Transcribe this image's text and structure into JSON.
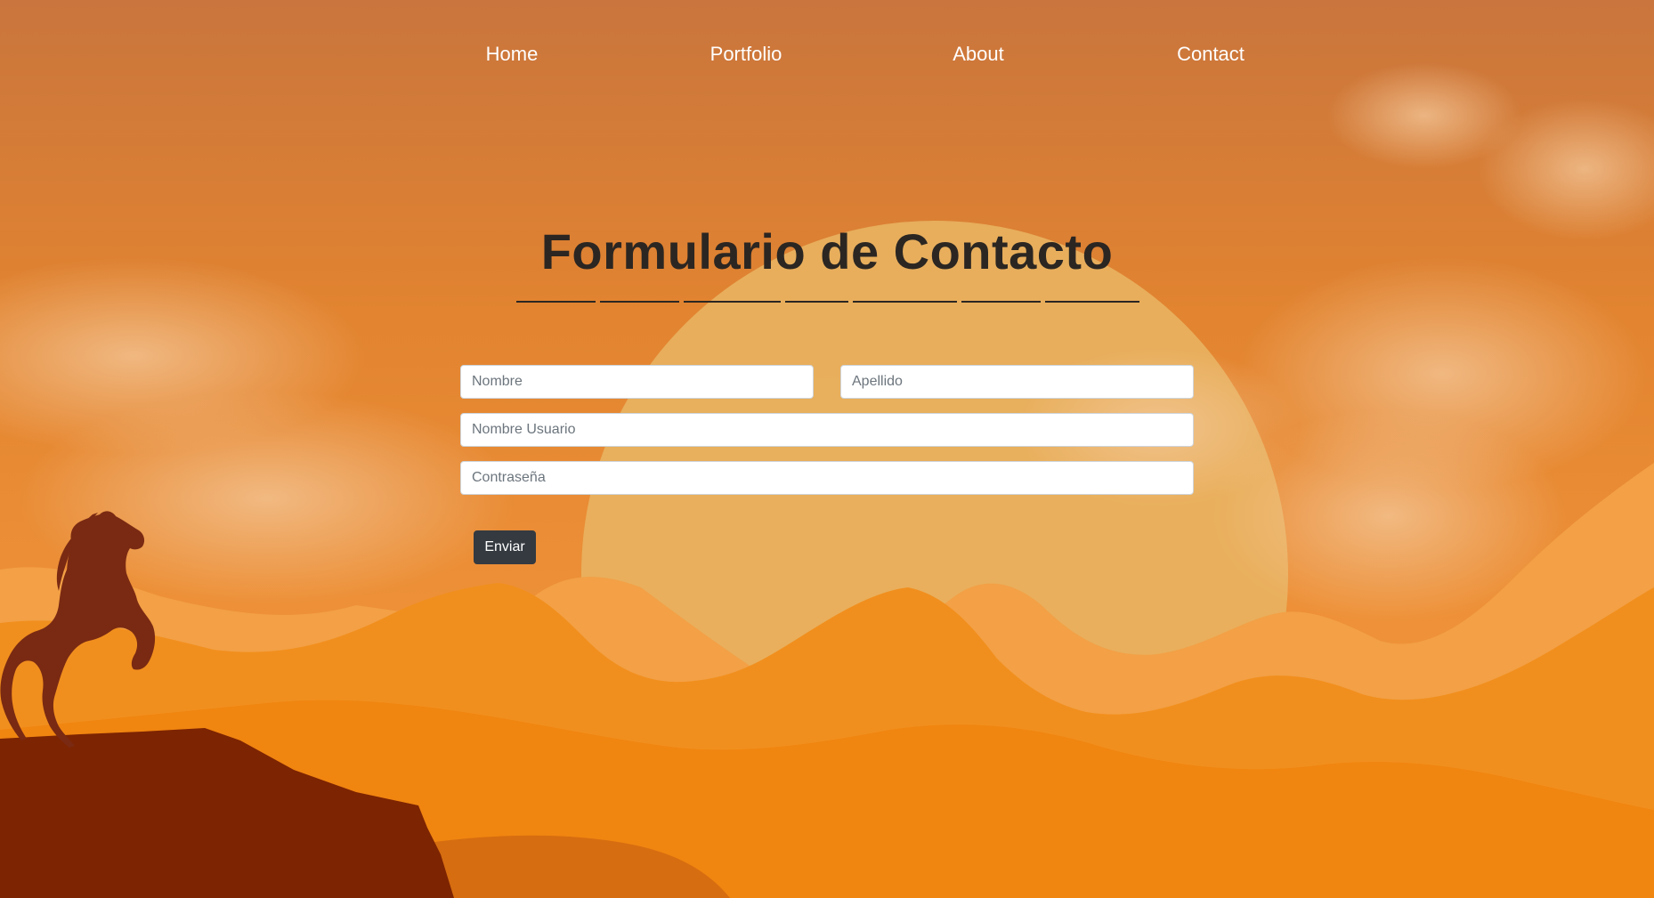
{
  "nav": {
    "items": [
      {
        "label": "Home"
      },
      {
        "label": "Portfolio"
      },
      {
        "label": "About"
      },
      {
        "label": "Contact"
      }
    ]
  },
  "form": {
    "title": "Formulario de Contacto",
    "first_name_placeholder": "Nombre",
    "last_name_placeholder": "Apellido",
    "username_placeholder": "Nombre Usuario",
    "password_placeholder": "Contraseña",
    "submit_label": "Enviar"
  },
  "colors": {
    "sky_top": "#c9753d",
    "sky_mid": "#e8892a",
    "sun": "#e8b25f",
    "mountain_far": "#f09a3c",
    "mountain_near": "#f08a12",
    "cliff": "#7d2402",
    "horse": "#7a2a12",
    "title_text": "#2b2622",
    "button_bg": "#343a40"
  },
  "icons": {
    "horse": "horse-silhouette-icon"
  }
}
